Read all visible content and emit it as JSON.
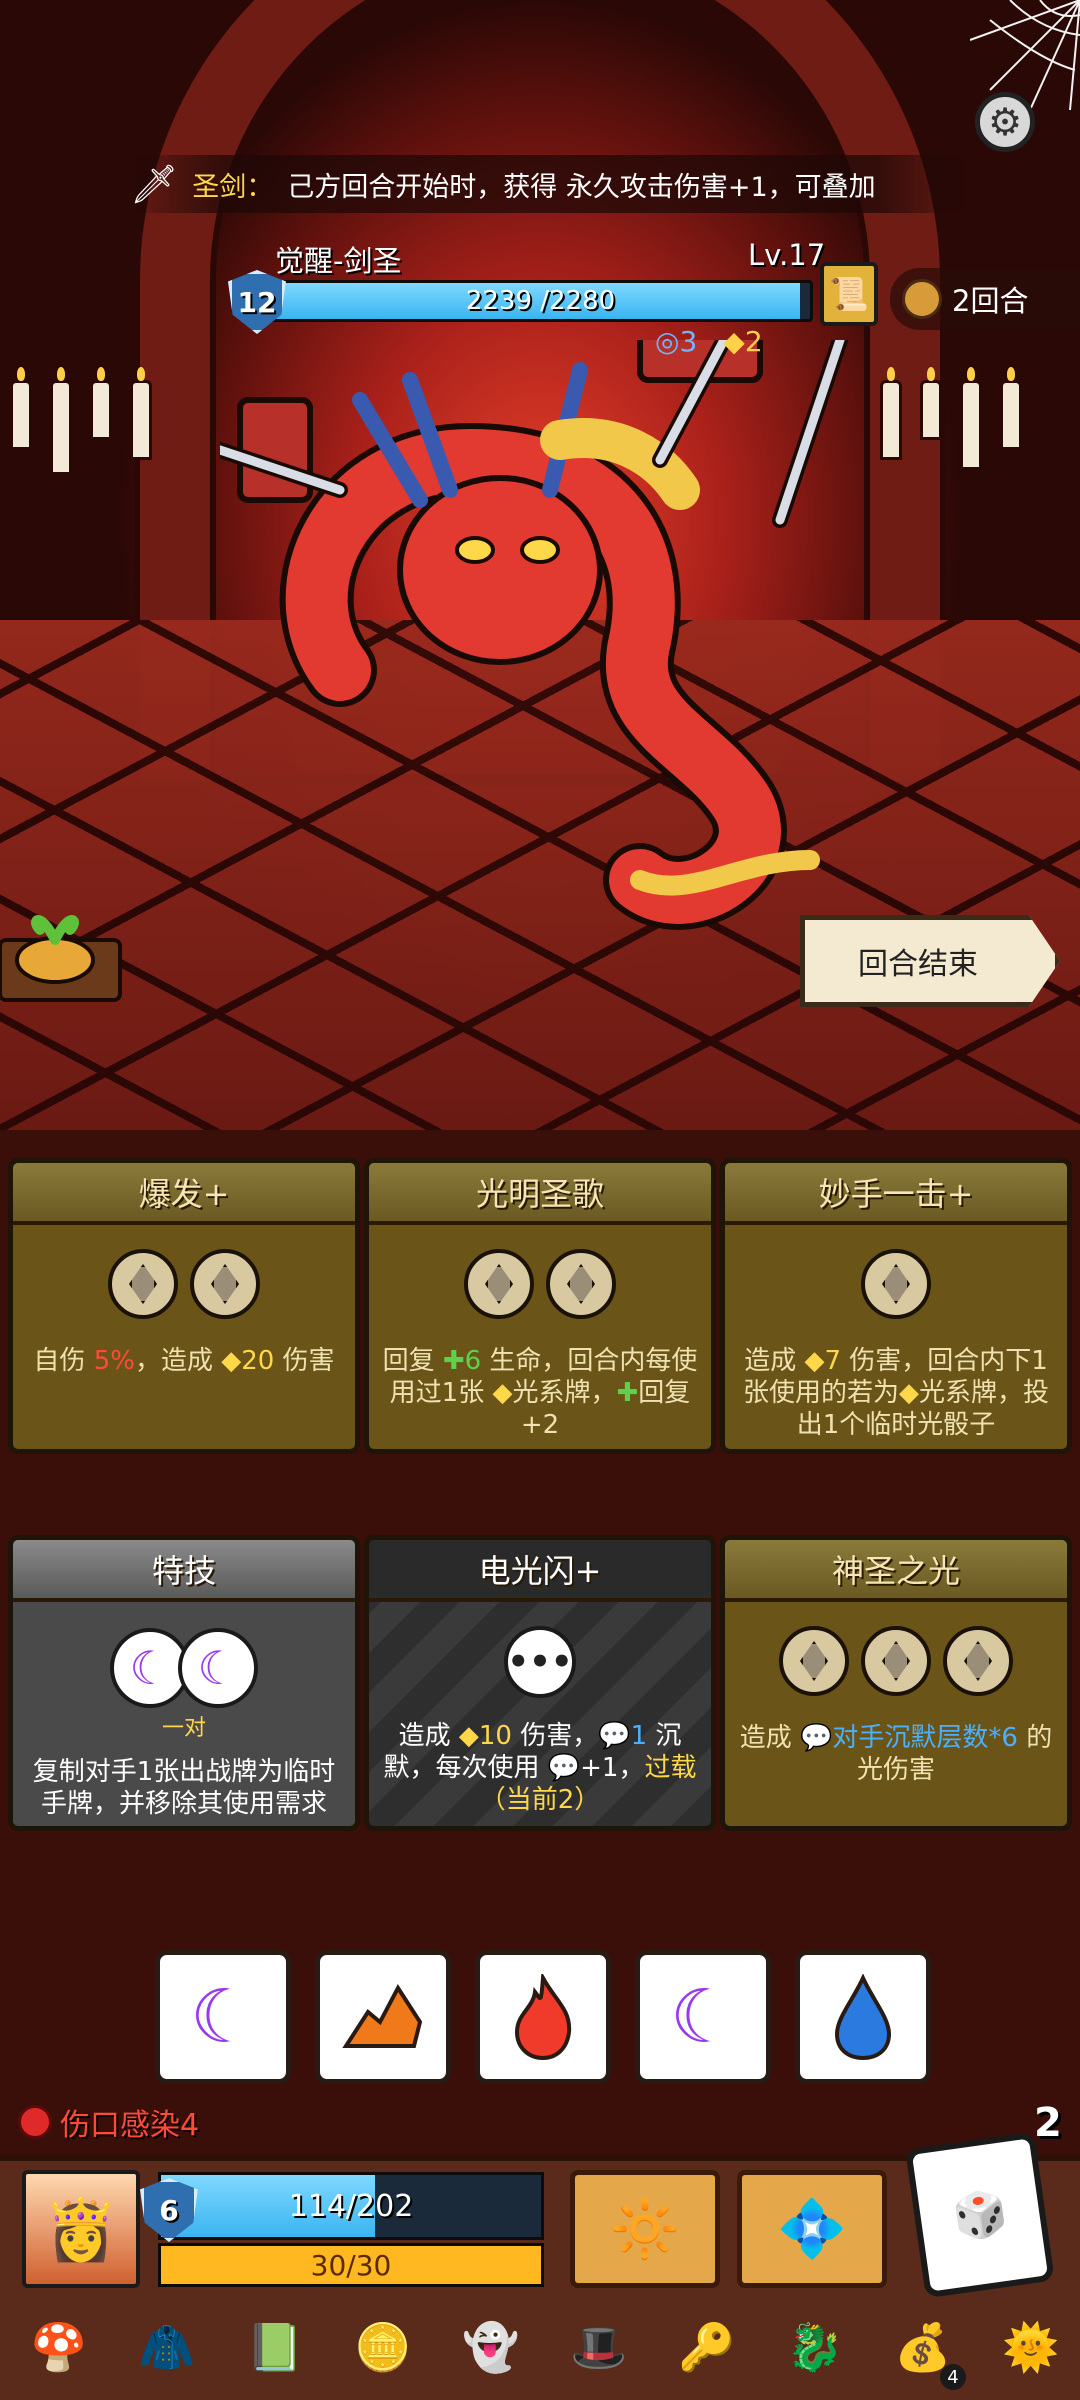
{
  "buff": {
    "label": "圣剑：",
    "text": "己方回合开始时，获得 永久攻击伤害+1，可叠加"
  },
  "enemy": {
    "name": "觉醒-剑圣",
    "level": "Lv.17",
    "shield": "12",
    "hp_text": "2239 /2280",
    "hp_fraction": 0.982,
    "status_blue": "3",
    "status_yellow": "2",
    "intent_icon": "scroll-icon"
  },
  "turn": {
    "text": "2回合"
  },
  "end_turn_label": "回合结束",
  "cards_row1": [
    {
      "title": "爆发+",
      "gems": 2,
      "desc_parts": [
        "自伤 ",
        "5%",
        "，造成 ",
        "◆20",
        " 伤害"
      ]
    },
    {
      "title": "光明圣歌",
      "gems": 2,
      "desc_parts": [
        "回复 ",
        "✚6",
        " 生命，回合内每使用过1张 ",
        "◆",
        "光系牌，",
        "✚",
        "回复+2"
      ]
    },
    {
      "title": "妙手一击+",
      "gems": 1,
      "desc_parts": [
        "造成 ",
        "◆7",
        " 伤害，回合内下1张使用的若为",
        "◆",
        "光系牌，投出1个临时光骰子"
      ]
    }
  ],
  "cards_row2": [
    {
      "title": "特技",
      "pair_label": "一对",
      "desc": "复制对手1张出战牌为临时手牌，并移除其使用需求"
    },
    {
      "title": "电光闪+",
      "desc_parts": [
        "造成 ",
        "◆10",
        " 伤害，",
        "💬1",
        " 沉默，每次使用 ",
        "💬",
        "+1，",
        "过载（当前2）"
      ]
    },
    {
      "title": "神圣之光",
      "gems": 3,
      "desc_parts": [
        "造成 ",
        "💬对手沉默层数*6",
        " 的光伤害"
      ]
    }
  ],
  "dice": [
    "moon",
    "earth",
    "fire",
    "moon",
    "water"
  ],
  "player": {
    "wound_text": "伤口感染4",
    "reroll_count": "2",
    "shield": "6",
    "hp_text": "114/202",
    "hp_fraction": 0.564,
    "energy_text": "30/30"
  },
  "items_badge": "4",
  "colors": {
    "hp_blue": "#3ab5f0",
    "energy": "#ffb820",
    "card_gold": "#6a5418",
    "danger": "#ff4a3a",
    "light_keyword": "#ffd84a"
  }
}
